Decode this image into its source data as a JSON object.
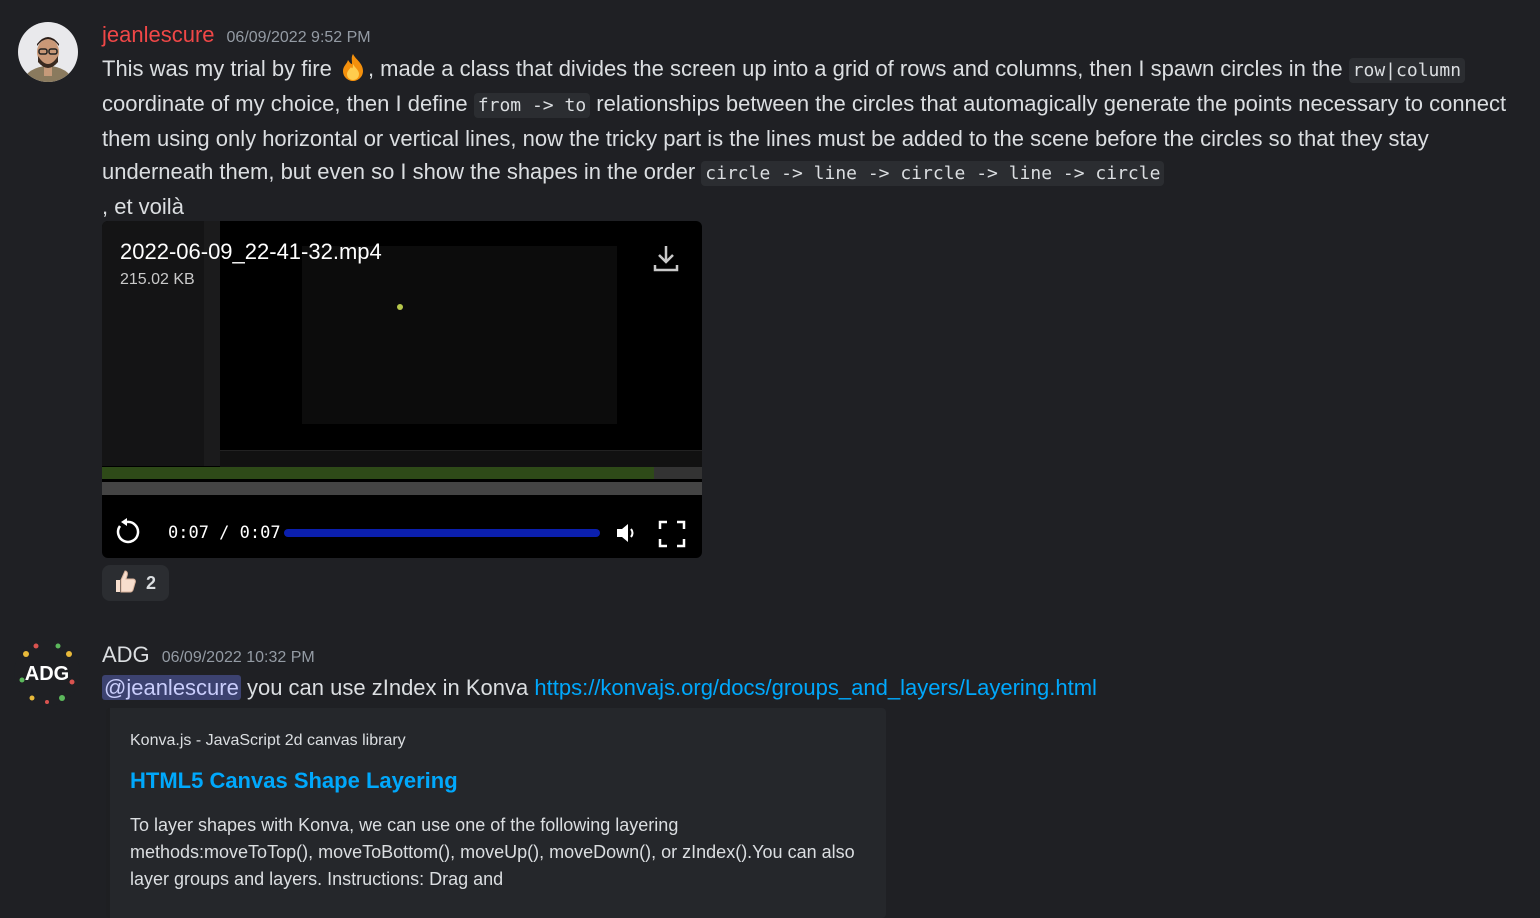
{
  "message1": {
    "username": "jeanlescure",
    "username_color": "#f04747",
    "timestamp": "06/09/2022 9:52 PM",
    "text_a": "This was my trial by fire ",
    "text_b": ", made a class that divides the screen up into a grid of rows and columns, then I spawn circles in the ",
    "code_a": "row|column",
    "text_c": " coordinate of my choice, then I define ",
    "code_b": "from -> to",
    "text_d": " relationships between the circles that automagically generate the points necessary to connect them using only horizontal or vertical lines, now the tricky part is the lines must be added to the scene before the circles so that they stay underneath them, but even so I show the shapes in the order ",
    "code_c": "circle -> line -> circle -> line -> circle ",
    "text_e": ", et voilà",
    "video": {
      "filename": "2022-06-09_22-41-32.mp4",
      "size": "215.02 KB",
      "time": "0:07 / 0:07",
      "progress_fraction": 1.0,
      "icons": [
        "download-icon",
        "replay-icon",
        "volume-icon",
        "fullscreen-icon"
      ]
    },
    "reaction": {
      "emoji": "thumbs-up-icon",
      "count": "2"
    }
  },
  "message2": {
    "username": "ADG",
    "timestamp": "06/09/2022 10:32 PM",
    "mention": "@jeanlescure",
    "text": " you can use zIndex in Konva ",
    "link": "https://konvajs.org/docs/groups_and_layers/Layering.html",
    "embed": {
      "provider": "Konva.js - JavaScript 2d canvas library",
      "title": "HTML5 Canvas Shape Layering",
      "description": "To layer shapes with Konva, we can use one of the following layering methods:moveToTop(), moveToBottom(), moveUp(), moveDown(), or zIndex().You can also layer groups and layers. Instructions: Drag and"
    }
  },
  "colors": {
    "background": "#1f2024",
    "link": "#00a8fc",
    "mention_bg": "#3c4270"
  }
}
